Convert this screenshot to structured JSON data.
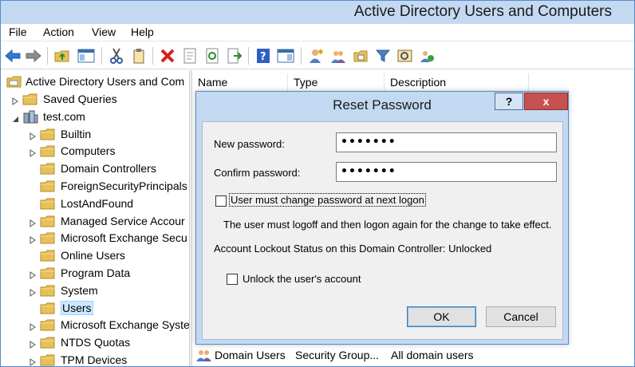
{
  "window": {
    "title": "Active Directory Users and Computers"
  },
  "menu": {
    "items": [
      "File",
      "Action",
      "View",
      "Help"
    ]
  },
  "toolbar": {
    "icons": [
      "back-arrow-icon",
      "forward-arrow-icon",
      "folder-up-icon",
      "show-console-tree-icon",
      "cut-icon",
      "copy-icon",
      "delete-icon",
      "properties-icon",
      "refresh-icon",
      "export-list-icon",
      "help-icon",
      "action-pane-icon",
      "new-user-icon",
      "new-group-icon",
      "new-ou-icon",
      "filter-icon",
      "find-icon",
      "add-to-group-icon"
    ]
  },
  "tree": {
    "root": "Active Directory Users and Com",
    "items": [
      {
        "label": "Saved Queries",
        "level": 1,
        "expander": "collapsed"
      },
      {
        "label": "test.com",
        "level": 1,
        "expander": "expanded"
      },
      {
        "label": "Builtin",
        "level": 2,
        "expander": "collapsed"
      },
      {
        "label": "Computers",
        "level": 2,
        "expander": "collapsed"
      },
      {
        "label": "Domain Controllers",
        "level": 2,
        "expander": "none"
      },
      {
        "label": "ForeignSecurityPrincipals",
        "level": 2,
        "expander": "none"
      },
      {
        "label": "LostAndFound",
        "level": 2,
        "expander": "none"
      },
      {
        "label": "Managed Service Accour",
        "level": 2,
        "expander": "collapsed"
      },
      {
        "label": "Microsoft Exchange Secu",
        "level": 2,
        "expander": "collapsed"
      },
      {
        "label": "Online Users",
        "level": 2,
        "expander": "none"
      },
      {
        "label": "Program Data",
        "level": 2,
        "expander": "collapsed"
      },
      {
        "label": "System",
        "level": 2,
        "expander": "collapsed"
      },
      {
        "label": "Users",
        "level": 2,
        "expander": "none",
        "selected": true
      },
      {
        "label": "Microsoft Exchange Syste",
        "level": 2,
        "expander": "collapsed"
      },
      {
        "label": "NTDS Quotas",
        "level": 2,
        "expander": "collapsed"
      },
      {
        "label": "TPM Devices",
        "level": 2,
        "expander": "collapsed"
      }
    ]
  },
  "list": {
    "columns": [
      "Name",
      "Type",
      "Description"
    ],
    "visible_row": {
      "name": "Domain Users",
      "type": "Security Group...",
      "description": "All domain users"
    }
  },
  "dialog": {
    "title": "Reset Password",
    "help_label": "?",
    "close_label": "x",
    "new_password_label": "New password:",
    "new_password_value": "•••••••",
    "confirm_password_label": "Confirm password:",
    "confirm_password_value": "•••••••",
    "must_change_label": "User must change password at next logon",
    "must_change_checked": false,
    "info_text": "The user must logoff and then logon again for the change to take effect.",
    "lockout_status": "Account Lockout Status on this Domain Controller: Unlocked",
    "unlock_label": "Unlock the user's account",
    "unlock_checked": false,
    "ok_label": "OK",
    "cancel_label": "Cancel"
  },
  "colors": {
    "titlebar": "#c3d9f2",
    "close_button": "#c75050",
    "folder": "#e8c05a",
    "selection": "#cde8ff"
  }
}
